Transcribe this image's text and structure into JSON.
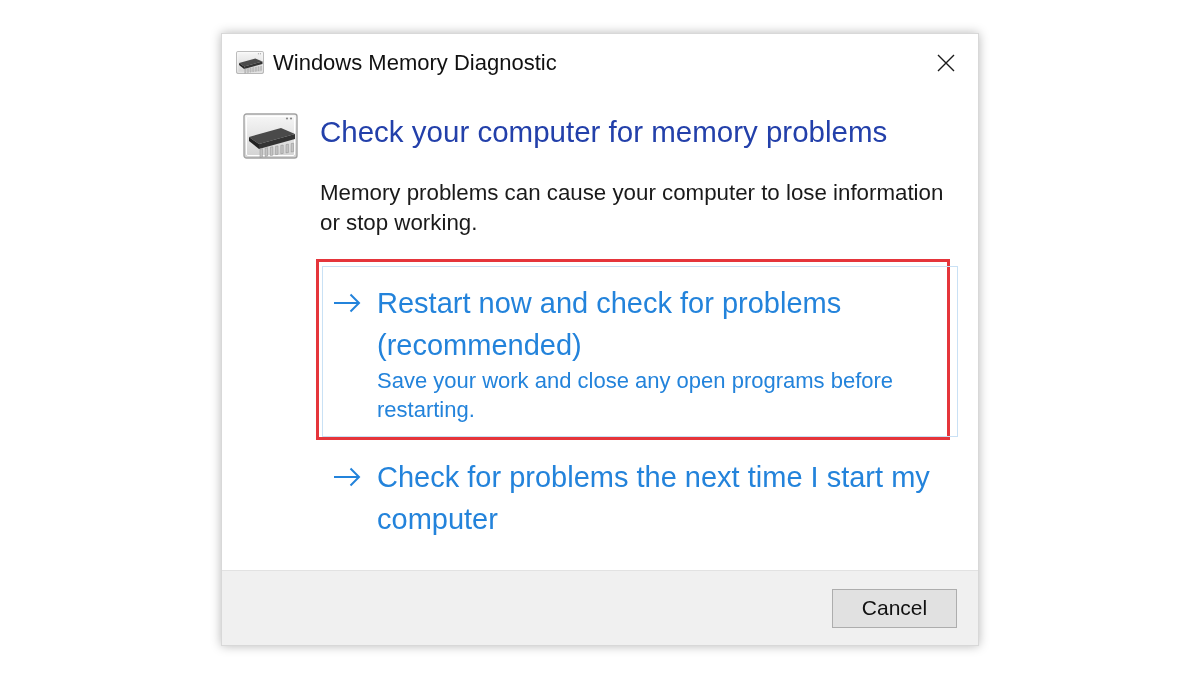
{
  "window": {
    "title": "Windows Memory Diagnostic"
  },
  "heading": "Check your computer for memory problems",
  "description": "Memory problems can cause your computer to lose information or stop working.",
  "options": [
    {
      "title": "Restart now and check for problems (recommended)",
      "note": "Save your work and close any open programs before restarting.",
      "selected": true,
      "highlighted": true
    },
    {
      "title": "Check for problems the next time I start my computer",
      "selected": false,
      "highlighted": false
    }
  ],
  "footer": {
    "cancel_button": "Cancel"
  }
}
